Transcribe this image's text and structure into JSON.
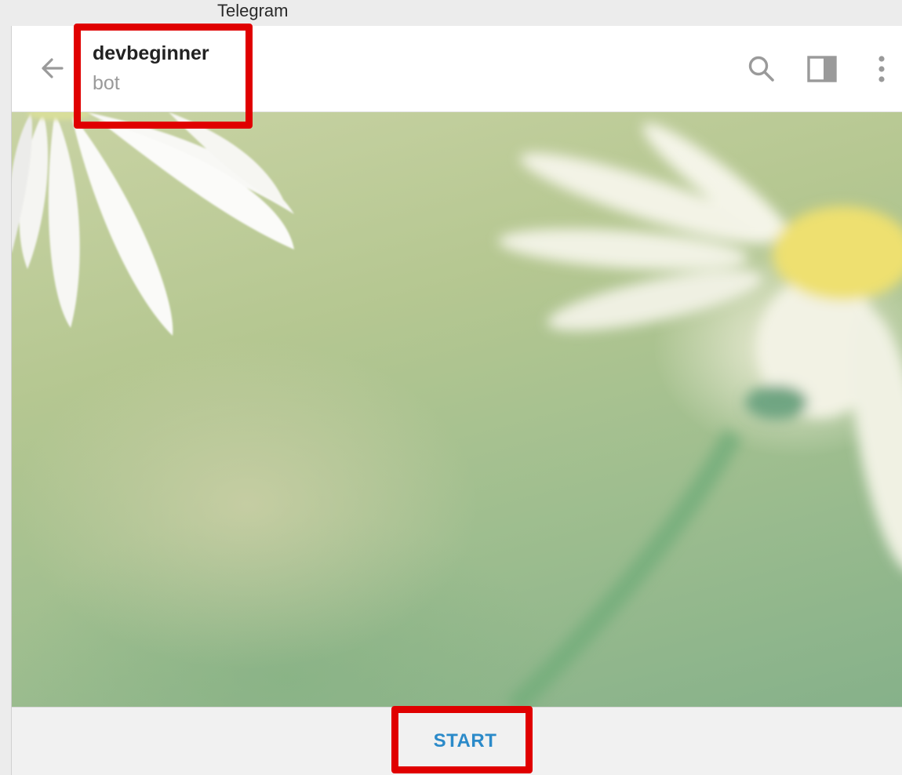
{
  "window": {
    "title": "Telegram"
  },
  "header": {
    "peer_name": "devbeginner",
    "peer_status": "bot",
    "icons": {
      "back": "back-arrow-icon",
      "search": "search-icon",
      "panel": "side-panel-icon",
      "more": "more-vertical-icon"
    }
  },
  "chat": {
    "background": "daisy-flower-wallpaper"
  },
  "footer": {
    "start_label": "START"
  },
  "colors": {
    "accent": "#2b8ac9",
    "highlight": "#e00000",
    "icon_gray": "#9a9a9a"
  }
}
